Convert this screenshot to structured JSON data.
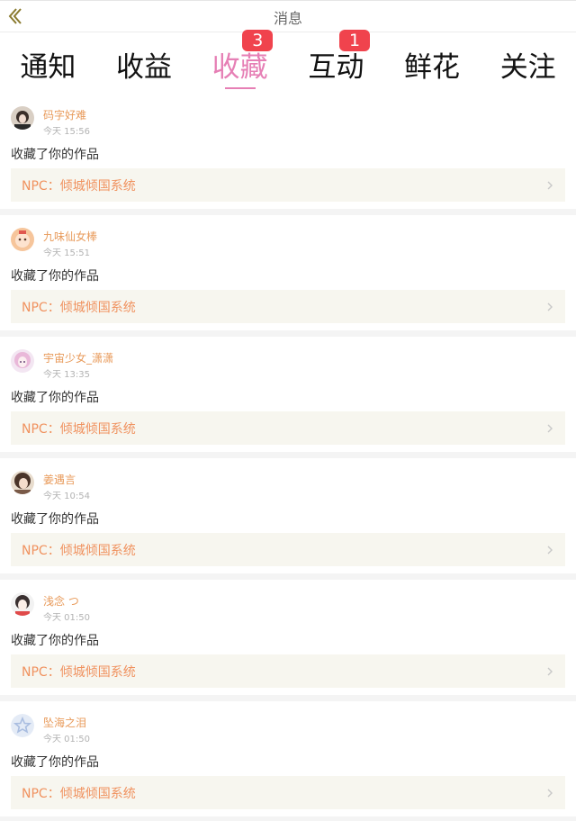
{
  "header": {
    "title": "消息",
    "back_icon": "chevron-double-left-icon",
    "accent": "#8a7a2e"
  },
  "tabs": [
    {
      "label": "通知",
      "badge": null,
      "active": false
    },
    {
      "label": "收益",
      "badge": null,
      "active": false
    },
    {
      "label": "收藏",
      "badge": "3",
      "active": true
    },
    {
      "label": "互动",
      "badge": "1",
      "active": false
    },
    {
      "label": "鲜花",
      "badge": null,
      "active": false
    },
    {
      "label": "关注",
      "badge": null,
      "active": false
    }
  ],
  "colors": {
    "active_tab": "#e67fb5",
    "badge": "#f0434d",
    "username": "#e89a5a",
    "work_title": "#f0925f",
    "work_bg": "#f7f6ef"
  },
  "messages": [
    {
      "user": "码字好难",
      "time": "今天 15:56",
      "action": "收藏了你的作品",
      "work": "NPC：倾城倾国系统",
      "avatar": "avatar-dark-hair"
    },
    {
      "user": "九味仙女棒",
      "time": "今天 15:51",
      "action": "收藏了你的作品",
      "work": "NPC：倾城倾国系统",
      "avatar": "avatar-orange-character"
    },
    {
      "user": "宇宙少女_潇潇",
      "time": "今天 13:35",
      "action": "收藏了你的作品",
      "work": "NPC：倾城倾国系统",
      "avatar": "avatar-pink-hair"
    },
    {
      "user": "姜遇言",
      "time": "今天 10:54",
      "action": "收藏了你的作品",
      "work": "NPC：倾城倾国系统",
      "avatar": "avatar-girl-portrait"
    },
    {
      "user": "浅念 つ",
      "time": "今天 01:50",
      "action": "收藏了你的作品",
      "work": "NPC：倾城倾国系统",
      "avatar": "avatar-white-character"
    },
    {
      "user": "坠海之泪",
      "time": "今天 01:50",
      "action": "收藏了你的作品",
      "work": "NPC：倾城倾国系统",
      "avatar": "avatar-default-star"
    }
  ]
}
